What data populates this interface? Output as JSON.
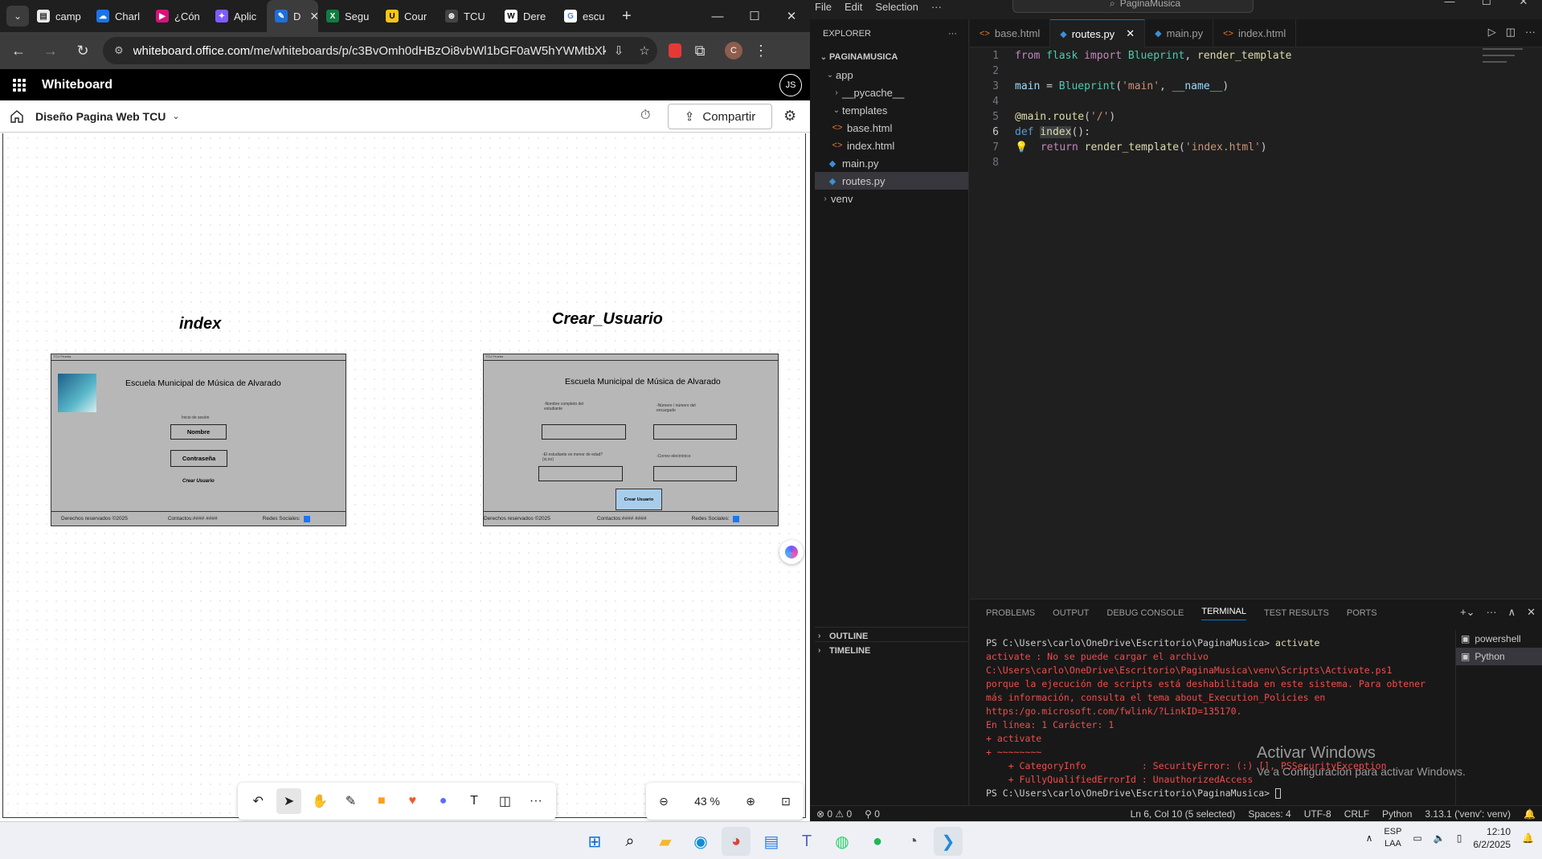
{
  "browser": {
    "tabs": [
      {
        "label": "camp",
        "icon": "doc-icon",
        "color": "#e8eaed"
      },
      {
        "label": "Charl",
        "icon": "onedrive-icon",
        "color": "#1a73e8"
      },
      {
        "label": "¿Cón",
        "icon": "arrow-icon",
        "color": "#d9127c"
      },
      {
        "label": "Aplic",
        "icon": "copilot-icon",
        "color": "#7d5cff"
      },
      {
        "label": "D",
        "icon": "whiteboard-icon",
        "color": "#1e6fd9"
      },
      {
        "label": "Segu",
        "icon": "excel-icon",
        "color": "#107c41"
      },
      {
        "label": "Cour",
        "icon": "udemy-icon",
        "color": "#f5c518"
      },
      {
        "label": "TCU",
        "icon": "chatgpt-icon",
        "color": "#444444"
      },
      {
        "label": "Dere",
        "icon": "wikipedia-icon",
        "color": "#ffffff"
      },
      {
        "label": "escu",
        "icon": "google-icon",
        "color": "#ffffff"
      }
    ],
    "url_host": "whiteboard.office.com",
    "url_path": "/me/whiteboards/p/c3BvOmh0dHBzOi8vbWl1bGF0aW5hYWMtbXkuc2h..."
  },
  "whiteboard": {
    "app_title": "Whiteboard",
    "avatar": "JS",
    "board_name": "Diseño Pagina Web TCU",
    "share_label": "Compartir",
    "zoom": "43 %",
    "frames": {
      "index": {
        "title": "index",
        "topbar": "TCU Prueba",
        "school": "Escuela Municipal de Música de Alvarado",
        "login_label": "Inicio de sesión",
        "name_btn": "Nombre",
        "pass_btn": "Contraseña",
        "create_link": "Crear Usuario",
        "footer_rights": "Derechos reservados ©2025",
        "footer_contact": "Contactos:#### ####",
        "footer_social": "Redes Sociales:"
      },
      "crear": {
        "title": "Crear_Usuario",
        "topbar": "TCU Prueba",
        "school": "Escuela Municipal de Música de Alvarado",
        "label_name": "-Nombre completo del estudiante",
        "label_phone": "-Número / número del encargado",
        "label_minor": "-El estudiante es menor de edad?(si,no)",
        "label_email": "-Correo electrónico",
        "cta": "Crear Usuario",
        "footer_rights": "Derechos reservados ©2025",
        "footer_contact": "Contactos:#### ####",
        "footer_social": "Redes Sociales:"
      }
    }
  },
  "vscode": {
    "menu": [
      "File",
      "Edit",
      "Selection",
      "···"
    ],
    "search": "PaginaMusica",
    "explorer_title": "EXPLORER",
    "project": "PAGINAMUSICA",
    "tree": [
      {
        "label": "app",
        "depth": 1,
        "kind": "folder-open"
      },
      {
        "label": "__pycache__",
        "depth": 2,
        "kind": "folder"
      },
      {
        "label": "templates",
        "depth": 2,
        "kind": "folder-open"
      },
      {
        "label": "base.html",
        "depth": 3,
        "kind": "html"
      },
      {
        "label": "index.html",
        "depth": 3,
        "kind": "html"
      },
      {
        "label": "main.py",
        "depth": 2,
        "kind": "py"
      },
      {
        "label": "routes.py",
        "depth": 2,
        "kind": "py",
        "selected": true
      },
      {
        "label": "venv",
        "depth": 1,
        "kind": "folder"
      }
    ],
    "outline": "OUTLINE",
    "timeline": "TIMELINE",
    "tabs": [
      {
        "label": "base.html",
        "kind": "html"
      },
      {
        "label": "routes.py",
        "kind": "py",
        "active": true
      },
      {
        "label": "main.py",
        "kind": "py"
      },
      {
        "label": "index.html",
        "kind": "html"
      }
    ],
    "code": [
      "from flask import Blueprint, render_template",
      "",
      "main = Blueprint('main', __name__)",
      "",
      "@main.route('/')",
      "def index():",
      "    return render_template('index.html')",
      ""
    ],
    "panel_tabs": [
      "PROBLEMS",
      "OUTPUT",
      "DEBUG CONSOLE",
      "TERMINAL",
      "TEST RESULTS",
      "PORTS"
    ],
    "terminal": {
      "prompt1": "PS C:\\Users\\carlo\\OneDrive\\Escritorio\\PaginaMusica>",
      "cmd1": "activate",
      "err": [
        "activate : No se puede cargar el archivo",
        "C:\\Users\\carlo\\OneDrive\\Escritorio\\PaginaMusica\\venv\\Scripts\\Activate.ps1",
        "porque la ejecución de scripts está deshabilitada en este sistema. Para obtener",
        "más información, consulta el tema about_Execution_Policies en",
        "https:/go.microsoft.com/fwlink/?LinkID=135170.",
        "En línea: 1 Carácter: 1",
        "+ activate",
        "+ ~~~~~~~~",
        "    + CategoryInfo          : SecurityError: (:) [], PSSecurityException",
        "    + FullyQualifiedErrorId : UnauthorizedAccess"
      ],
      "prompt2": "PS C:\\Users\\carlo\\OneDrive\\Escritorio\\PaginaMusica>"
    },
    "terminals": [
      "powershell",
      "Python"
    ],
    "watermark_title": "Activar Windows",
    "watermark_sub": "Ve a Configuración para activar Windows.",
    "status": {
      "errors": "⊗ 0 ⚠ 0",
      "ports": "⚲ 0",
      "position": "Ln 6, Col 10 (5 selected)",
      "spaces": "Spaces: 4",
      "encoding": "UTF-8",
      "eol": "CRLF",
      "lang": "Python",
      "interp": "3.13.1 ('venv': venv)"
    }
  },
  "taskbar": {
    "lang1": "ESP",
    "lang2": "LAA",
    "time": "12:10",
    "date": "6/2/2025"
  }
}
